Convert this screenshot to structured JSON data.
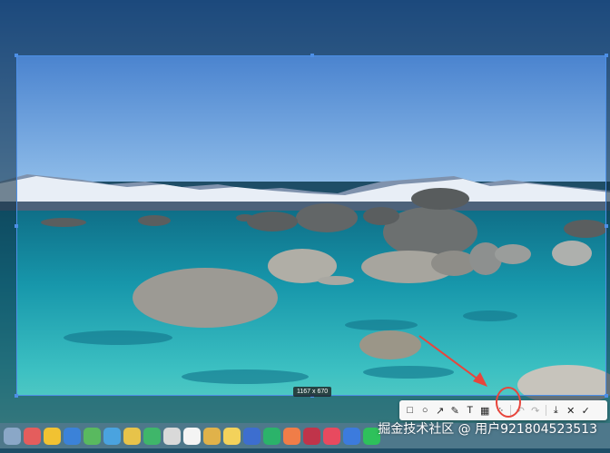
{
  "capture": {
    "size_label": "1167 x 670"
  },
  "toolbar": {
    "tools": [
      {
        "name": "rectangle-tool",
        "icon": "rectangle-icon",
        "glyph": "□"
      },
      {
        "name": "ellipse-tool",
        "icon": "circle-icon",
        "glyph": "○"
      },
      {
        "name": "arrow-tool",
        "icon": "arrow-icon",
        "glyph": "↗"
      },
      {
        "name": "pen-tool",
        "icon": "pen-icon",
        "glyph": "✎"
      },
      {
        "name": "text-tool",
        "icon": "text-icon",
        "glyph": "T"
      },
      {
        "name": "mosaic-tool",
        "icon": "mosaic-icon",
        "glyph": "▦"
      },
      {
        "name": "ocr-tool",
        "icon": "magic-wand-icon",
        "glyph": "⁘"
      },
      {
        "name": "undo-button",
        "icon": "undo-icon",
        "glyph": "↶"
      },
      {
        "name": "redo-button",
        "icon": "redo-icon",
        "glyph": "↷"
      },
      {
        "name": "download-button",
        "icon": "download-icon",
        "glyph": "⤓"
      },
      {
        "name": "cancel-button",
        "icon": "close-icon",
        "glyph": "✕"
      },
      {
        "name": "confirm-button",
        "icon": "check-icon",
        "glyph": "✓"
      }
    ]
  },
  "watermark": {
    "text": "掘金技术社区 @ 用户921804523513"
  },
  "colors": {
    "selection": "#4d8fe6",
    "annotation": "#e8453c",
    "sky": "#3f7fd0",
    "water": "#1fa3b6"
  }
}
